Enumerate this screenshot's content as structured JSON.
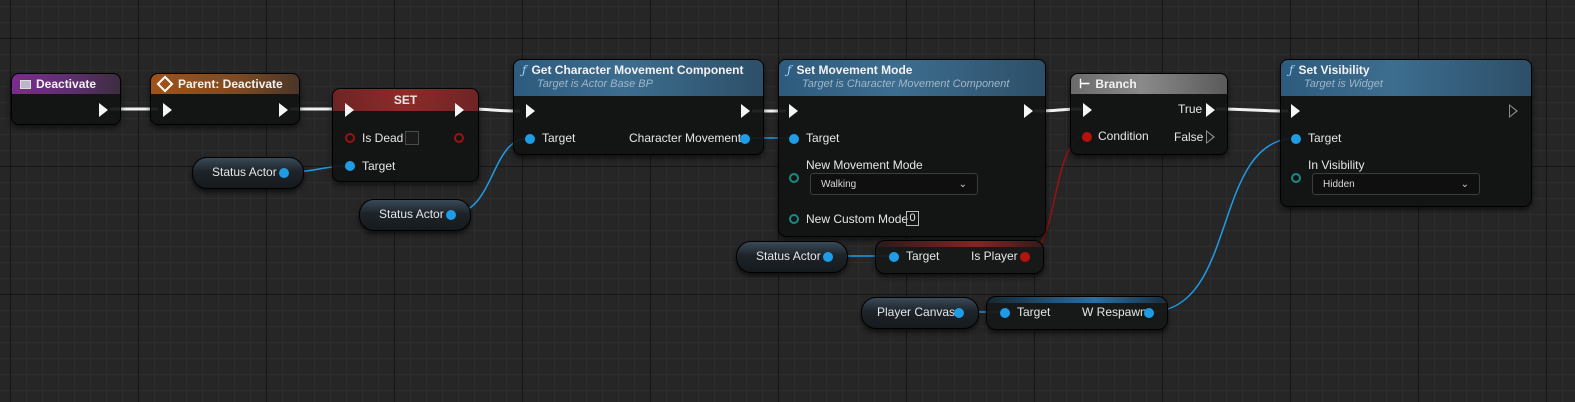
{
  "nodes": {
    "deactivate": {
      "title": "Deactivate",
      "icon": "event-icon"
    },
    "parent_deactivate": {
      "title": "Parent: Deactivate",
      "icon": "override-event-icon"
    },
    "set": {
      "title": "SET",
      "var_label": "Is Dead",
      "target_label": "Target"
    },
    "get_cmc": {
      "title": "Get Character Movement Component",
      "subtitle": "Target is Actor Base BP",
      "in_label": "Target",
      "out_label": "Character Movement"
    },
    "set_mode": {
      "title": "Set Movement Mode",
      "subtitle": "Target is Character Movement Component",
      "target_label": "Target",
      "mode_label": "New Movement Mode",
      "mode_value": "Walking",
      "custom_label": "New Custom Mode",
      "custom_value": "0"
    },
    "branch": {
      "title": "Branch",
      "condition_label": "Condition",
      "true_label": "True",
      "false_label": "False"
    },
    "set_visibility": {
      "title": "Set Visibility",
      "subtitle": "Target is Widget",
      "target_label": "Target",
      "vis_label": "In Visibility",
      "vis_value": "Hidden"
    },
    "status_actor_1": {
      "label": "Status Actor"
    },
    "status_actor_2": {
      "label": "Status Actor"
    },
    "status_actor_3": {
      "label": "Status Actor"
    },
    "is_player": {
      "target_label": "Target",
      "out_label": "Is Player"
    },
    "player_canvas": {
      "label": "Player Canvas"
    },
    "w_respawn": {
      "target_label": "Target",
      "out_label": "W Respawn"
    }
  },
  "colors": {
    "exec": "#f5f5f5",
    "object_pin": "#1f9ce6",
    "bool_pin": "#b3130b",
    "byte_pin": "#1b8a82",
    "grid_bg": "#262626"
  }
}
